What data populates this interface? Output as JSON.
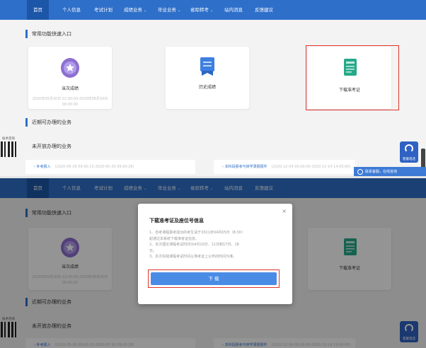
{
  "nav": {
    "items": [
      {
        "label": "首页",
        "dropdown": false
      },
      {
        "label": "个人信息",
        "dropdown": false
      },
      {
        "label": "考试计划",
        "dropdown": false
      },
      {
        "label": "成绩业务",
        "dropdown": true
      },
      {
        "label": "毕业业务",
        "dropdown": true
      },
      {
        "label": "省际转考",
        "dropdown": true
      },
      {
        "label": "站内消息",
        "dropdown": false
      },
      {
        "label": "反馈建议",
        "dropdown": false
      }
    ],
    "caret": "⌄"
  },
  "sections": {
    "quick_entry": "常用功能快速入口",
    "recent": "近期可办理的业务",
    "not_open": "未开放办理的业务"
  },
  "cards": {
    "score": {
      "label": "当次成绩",
      "sub_line1": "2020年05月30日 22:00:00-2020年06月30日",
      "sub_line2": "00:00:00"
    },
    "history": {
      "label": "历史成绩"
    },
    "admission": {
      "label": "下载准考证"
    }
  },
  "side": {
    "qr_label": "技术咨询",
    "service_label": "客服电话",
    "chat_label": "联系客服，在线咨询"
  },
  "todo": {
    "left_label": "补考报入",
    "left_dates": "(2020-05-29 09:00:15-2020-05-30 09:00:26)",
    "right_label": "本科段报考与转学录报报件",
    "right_dates": "(2020-12-04 00:00:00-2020-12-14 14:00:00)"
  },
  "modal": {
    "title": "下载准考证及座位号信息",
    "close": "×",
    "lines": [
      "1、自考课程报考成功的考生请于2021年04月05日（8:30）",
      "起通过本系统下载准考证信息。",
      "2、本次理论课程考试时间为4月10日、11日和17日、18",
      "日。",
      "3、本次实践课程考试时间以准考证上公布的时间为准。"
    ],
    "button": "下 载"
  },
  "colors": {
    "nav_bg": "#2e6fc9",
    "highlight": "#e0352b",
    "score_icon": "#8d6fd1",
    "history_icon": "#3d7fe0",
    "admission_icon": "#26a98a",
    "button": "#4a8be6"
  },
  "icons": {
    "score": "medal-icon",
    "history": "ribbon-icon",
    "admission": "certificate-icon",
    "service": "headset-icon",
    "chat": "chat-icon",
    "close": "close-icon",
    "arrow": "chevron-right-icon"
  }
}
